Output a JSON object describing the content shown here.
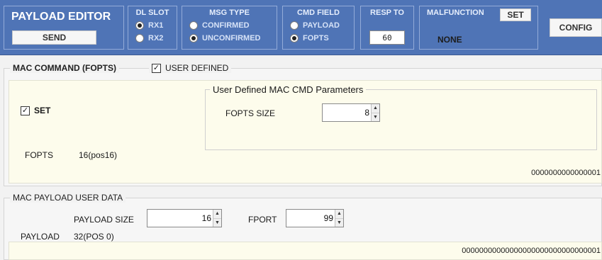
{
  "toolbar": {
    "title": "PAYLOAD EDITOR",
    "send_label": "SEND",
    "dl_slot": {
      "title": "DL SLOT",
      "options": [
        "RX1",
        "RX2"
      ],
      "selected": "RX1"
    },
    "msg_type": {
      "title": "MSG TYPE",
      "options": [
        "CONFIRMED",
        "UNCONFIRMED"
      ],
      "selected": "UNCONFIRMED"
    },
    "cmd_field": {
      "title": "CMD FIELD",
      "options": [
        "PAYLOAD",
        "FOPTS"
      ],
      "selected": "FOPTS"
    },
    "resp_to": {
      "title": "RESP TO",
      "value": "60"
    },
    "malfunction": {
      "title": "MALFUNCTION",
      "set_label": "SET",
      "value": "NONE"
    },
    "config_label": "CONFIG"
  },
  "mac_command": {
    "title": "MAC COMMAND (FOPTS)",
    "user_defined_label": "USER DEFINED",
    "user_defined_checked": true,
    "set_label": "SET",
    "set_checked": true,
    "params_title": "User Defined MAC CMD Parameters",
    "fopts_size_label": "FOPTS SIZE",
    "fopts_size_value": "8",
    "fopts_label": "FOPTS",
    "fopts_info": "16(pos16)",
    "hex": "0000000000000001"
  },
  "mac_payload": {
    "title": "MAC PAYLOAD USER DATA",
    "payload_size_label": "PAYLOAD SIZE",
    "payload_size_value": "16",
    "fport_label": "FPORT",
    "fport_value": "99",
    "payload_label": "PAYLOAD",
    "payload_info": "32(POS 0)",
    "hex": "00000000000000000000000000000001"
  },
  "colors": {
    "toolbar_bg": "#4f74b6",
    "panel_bg": "#fdfcec",
    "header_text": "#e6eefc"
  }
}
